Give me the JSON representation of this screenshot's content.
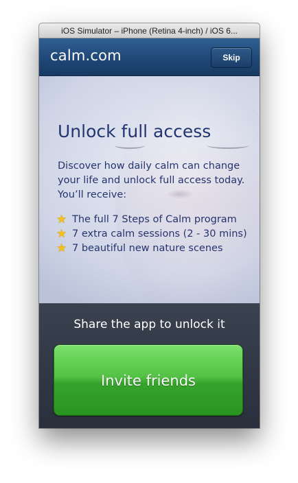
{
  "window": {
    "title": "iOS Simulator – iPhone (Retina 4-inch) / iOS 6..."
  },
  "navbar": {
    "brand": "calm.com",
    "skip_label": "Skip"
  },
  "hero": {
    "heading": "Unlock full access",
    "description": "Discover how daily calm can change your life and unlock full access today. You’ll receive:",
    "benefits": [
      {
        "icon": "star-icon",
        "text": "The full 7 Steps of Calm program"
      },
      {
        "icon": "star-icon",
        "text": "7 extra calm sessions (2 - 30 mins)"
      },
      {
        "icon": "star-icon",
        "text": "7 beautiful new nature scenes"
      }
    ]
  },
  "share": {
    "title": "Share the app to unlock it",
    "invite_label": "Invite friends"
  },
  "colors": {
    "navbar": "#1e4674",
    "heading_text": "#243470",
    "invite_button": "#52c144",
    "star": "#f2c21a",
    "share_panel": "#2f3540"
  }
}
